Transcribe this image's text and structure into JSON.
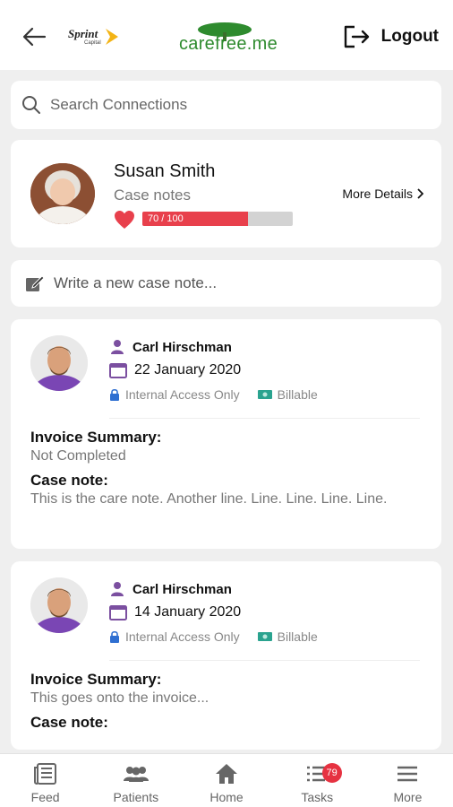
{
  "header": {
    "sprint_brand": "Sprint",
    "sprint_sub": "Capital",
    "logo_text": "carefree.me",
    "logout_label": "Logout"
  },
  "search": {
    "placeholder": "Search Connections"
  },
  "profile": {
    "name": "Susan Smith",
    "subtitle": "Case notes",
    "score_text": "70 / 100",
    "score_value": 70,
    "score_max": 100,
    "more_details": "More Details"
  },
  "new_note": {
    "placeholder": "Write a new case note..."
  },
  "notes": [
    {
      "author": "Carl Hirschman",
      "date": "22 January 2020",
      "access": "Internal Access Only",
      "billing": "Billable",
      "invoice_heading": "Invoice Summary:",
      "invoice_text": "Not Completed",
      "note_heading": "Case note:",
      "note_text": "This is the care note. Another line. Line. Line. Line. Line."
    },
    {
      "author": "Carl Hirschman",
      "date": "14 January 2020",
      "access": "Internal Access Only",
      "billing": "Billable",
      "invoice_heading": "Invoice Summary:",
      "invoice_text": "This goes onto the invoice...",
      "note_heading": "Case note:",
      "note_text": ""
    }
  ],
  "nav": [
    {
      "label": "Feed",
      "icon": "feed-icon"
    },
    {
      "label": "Patients",
      "icon": "patients-icon"
    },
    {
      "label": "Home",
      "icon": "home-icon"
    },
    {
      "label": "Tasks",
      "icon": "tasks-icon",
      "badge": "79"
    },
    {
      "label": "More",
      "icon": "menu-icon"
    }
  ],
  "colors": {
    "accent_red": "#e8404c",
    "brand_green": "#2e8b2e",
    "icon_purple": "#7b4fa0",
    "badge_red": "#e63241"
  }
}
